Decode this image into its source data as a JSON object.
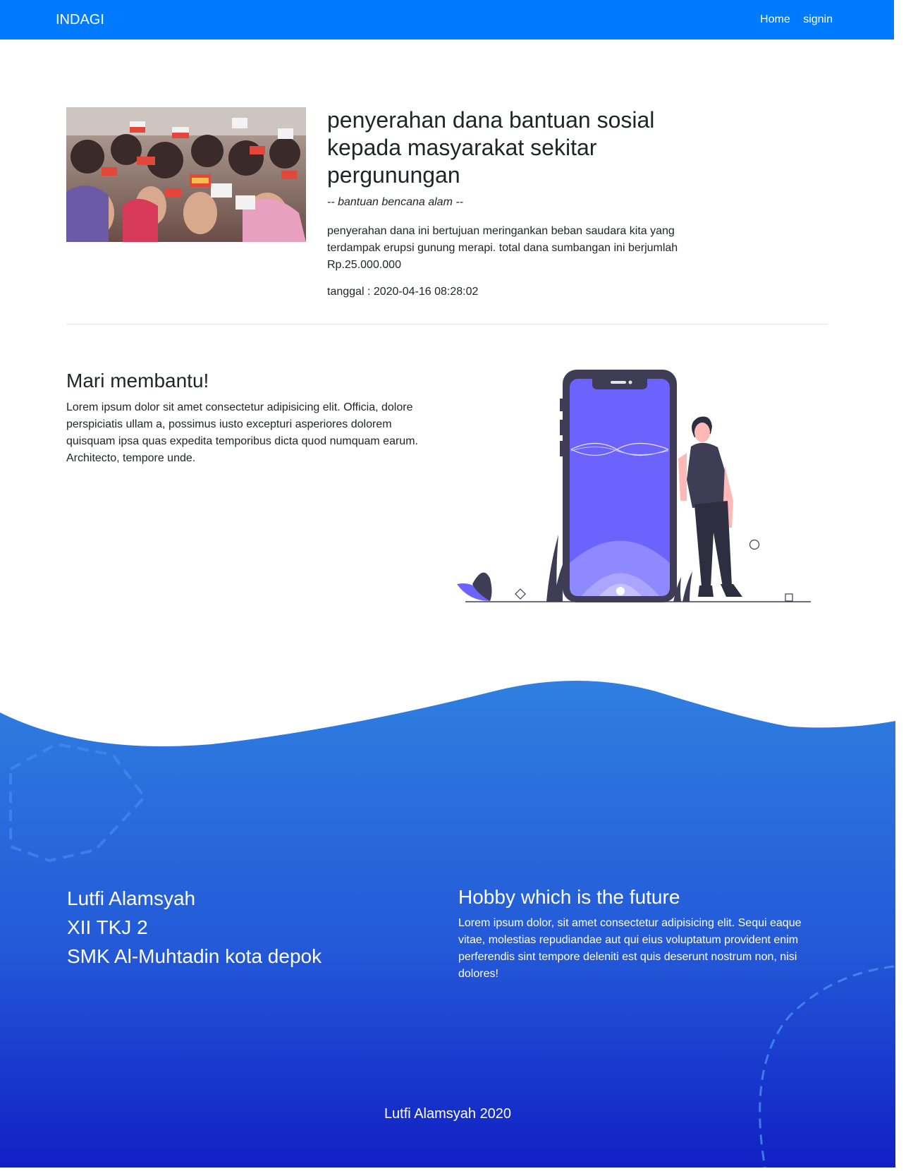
{
  "navbar": {
    "brand": "INDAGI",
    "links": [
      "Home",
      "signin"
    ]
  },
  "news": {
    "title": "penyerahan dana bantuan sosial kepada masyarakat sekitar pergunungan",
    "subtitle": "-- bantuan bencana alam --",
    "body": "penyerahan dana ini bertujuan meringankan beban saudara kita yang terdampak erupsi gunung merapi. total dana sumbangan ini berjumlah Rp.25.000.000",
    "date": "tanggal : 2020-04-16 08:28:02"
  },
  "help": {
    "title": "Mari membantu!",
    "body": "Lorem ipsum dolor sit amet consectetur adipisicing elit. Officia, dolore perspiciatis ullam a, possimus iusto excepturi asperiores dolorem quisquam ipsa quas expedita temporibus dicta quod numquam earum. Architecto, tempore unde."
  },
  "footer": {
    "owner": {
      "name": "Lutfi Alamsyah",
      "class": "XII TKJ 2",
      "school": "SMK Al-Muhtadin kota depok"
    },
    "hobby": {
      "title": "Hobby which is the future",
      "body": "Lorem ipsum dolor, sit amet consectetur adipisicing elit. Sequi eaque vitae, molestias repudiandae aut qui eius voluptatum provident enim perferendis sint tempore deleniti est quis deserunt nostrum non, nisi dolores!"
    },
    "copyright": "Lutfi Alamsyah 2020"
  },
  "colors": {
    "navbar": "#007bff",
    "footer_top": "#2f7fe0",
    "footer_bottom": "#1120c4",
    "illustration_accent": "#6c63ff"
  }
}
